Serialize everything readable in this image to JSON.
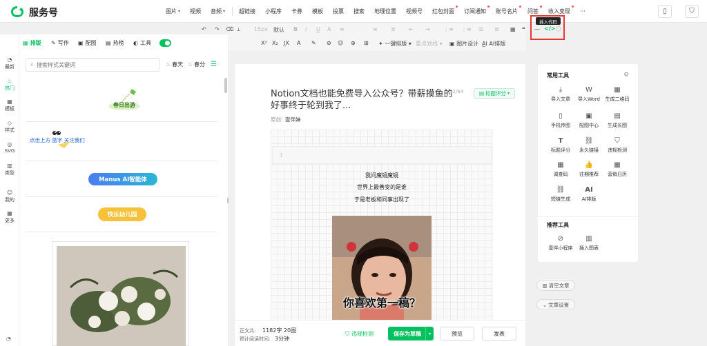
{
  "brand": {
    "name": "服务号",
    "color": "#07c160"
  },
  "top_nav": {
    "media": [
      {
        "label": "图片",
        "dropdown": true
      },
      {
        "label": "视频"
      },
      {
        "label": "音频",
        "dropdown": true
      }
    ],
    "insert": [
      {
        "label": "超链接"
      },
      {
        "label": "小程序"
      },
      {
        "label": "卡券"
      },
      {
        "label": "模板"
      },
      {
        "label": "投票"
      },
      {
        "label": "搜索"
      },
      {
        "label": "地理位置"
      },
      {
        "label": "视频号"
      },
      {
        "label": "红包封面",
        "dot": true
      },
      {
        "label": "订阅通知",
        "dot": true
      },
      {
        "label": "账号名片",
        "dot": true
      },
      {
        "label": "问答",
        "dot": true
      },
      {
        "label": "收入变现",
        "dot": true
      },
      {
        "label": "···"
      }
    ]
  },
  "left_tabs": [
    "排版",
    "写作",
    "配图",
    "热榜",
    "工具"
  ],
  "rail": [
    "最新",
    "热门",
    "模板",
    "样式",
    "SVG",
    "类型",
    "我的",
    "更多"
  ],
  "search": {
    "placeholder": "搜索样式关键词"
  },
  "chips": [
    "春天",
    "春分"
  ],
  "templates": {
    "t1": "春日出游",
    "t2": "点击上方 蓝字 关注我们",
    "t3": "Manus AI智能体",
    "t4": "快乐幼儿园"
  },
  "toolbar": {
    "row1": [
      "↶",
      "↷",
      "⌫",
      "⟂",
      "15px",
      "默认",
      "B",
      "I",
      "U",
      "A",
      "≡",
      "≡",
      "≣",
      "⇤",
      "⇥",
      "⋮≡",
      "⋮≡",
      "☰",
      "≣",
      "▦",
      "❝"
    ],
    "row2": [
      "X²",
      "X₂",
      "I̲X",
      "A",
      "✎",
      "⊘",
      "☺",
      "⊕",
      "⊞"
    ],
    "one_click": "一键排版",
    "rewrite": "重点划线",
    "image_design": "图片设计",
    "ai": "AI排版",
    "tooltip": "插入代码"
  },
  "article": {
    "title": "Notion文档也能免费导入公众号？带薪摸鱼的好事终于轮到我了...",
    "counter": "32/64",
    "score_label": "标题评分",
    "author_label": "原创:",
    "author": "壹伴妹",
    "line_number": "1",
    "poem": [
      "我问魔镜魔镜",
      "世界上最善变的是谁",
      "于是老板和同事出现了"
    ],
    "meme_caption": "你喜欢第一稿？"
  },
  "footer": {
    "word_count_label": "正文共:",
    "word_count": "1182字 20图",
    "read_time_label": "预计阅读时间:",
    "read_time": "3分钟",
    "check": "违规检测",
    "save": "保存为草稿",
    "preview": "预览",
    "publish": "发表"
  },
  "right_panel": {
    "common_title": "常用工具",
    "tools": [
      {
        "label": "导入文章",
        "icon": "⤓"
      },
      {
        "label": "导入Word",
        "icon": "W"
      },
      {
        "label": "生成二维码",
        "icon": "▦"
      },
      {
        "label": "手机传图",
        "icon": "▯"
      },
      {
        "label": "配图中心",
        "icon": "▣"
      },
      {
        "label": "生成长图",
        "icon": "▤"
      },
      {
        "label": "标题评分",
        "icon": "T"
      },
      {
        "label": "永久链接",
        "icon": "⛓"
      },
      {
        "label": "违规检测",
        "icon": "⛉"
      },
      {
        "label": "调查码",
        "icon": "▦"
      },
      {
        "label": "往期推荐",
        "icon": "👍"
      },
      {
        "label": "营销日历",
        "icon": "▦"
      },
      {
        "label": "短链生成",
        "icon": "⛓"
      },
      {
        "label": "AI排版",
        "icon": "AI"
      }
    ],
    "recommend_title": "推荐工具",
    "recommend": [
      {
        "label": "壹伴小程序",
        "icon": "⊘"
      },
      {
        "label": "插入图表",
        "icon": "▥"
      }
    ],
    "clear": "清空文章",
    "settings": "文章设置"
  }
}
